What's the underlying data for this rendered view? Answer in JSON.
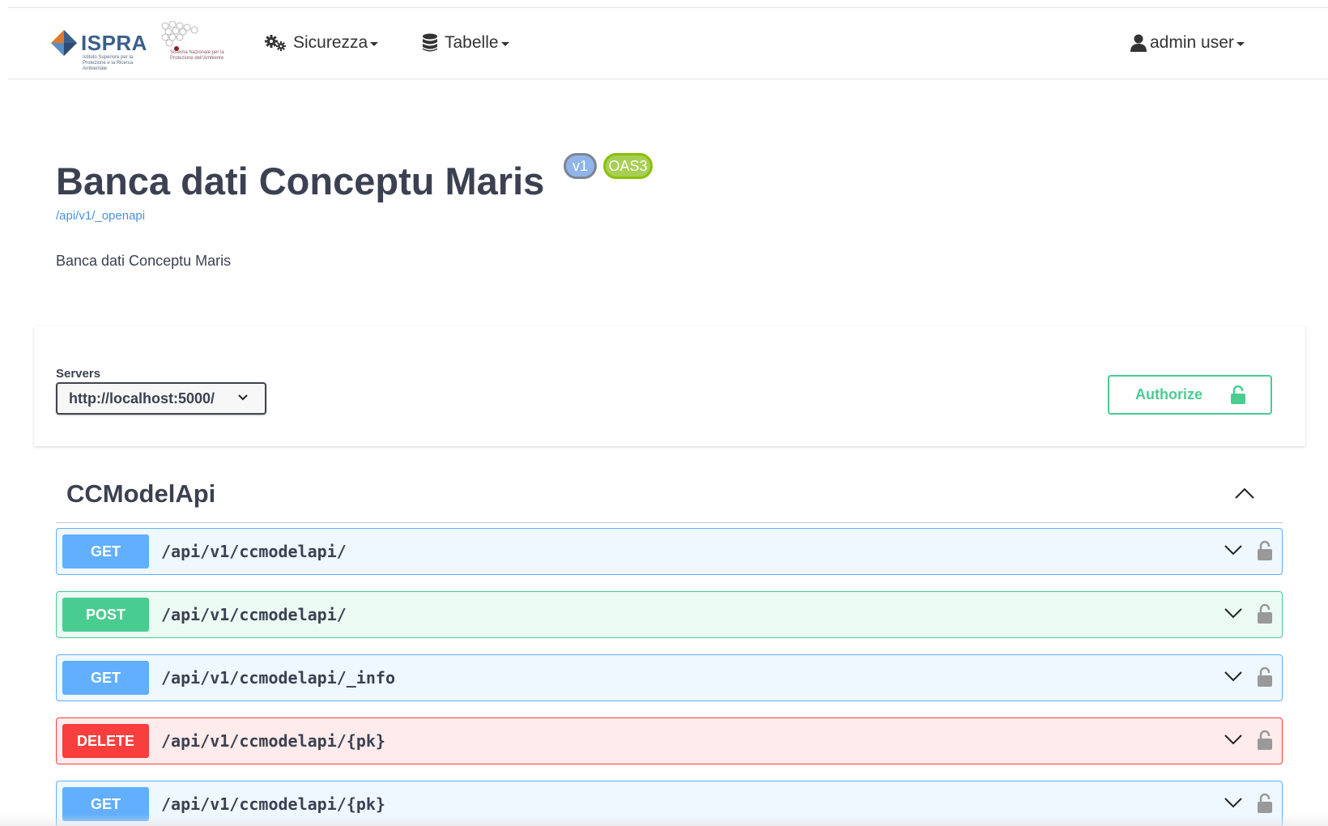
{
  "navbar": {
    "brand": {
      "ispra_name": "ISPRA",
      "ispra_sub": "Istituto Superiore per la Protezione e la Ricerca Ambientale",
      "snpa_sub": "Sistema Nazionale per la Protezione dell'Ambiente"
    },
    "menus": [
      {
        "label": "Sicurezza",
        "icon": "gears-icon"
      },
      {
        "label": "Tabelle",
        "icon": "database-icon"
      }
    ],
    "user": {
      "label": "admin user",
      "icon": "user-icon"
    }
  },
  "info": {
    "title": "Banca dati Conceptu Maris",
    "version_badge": "v1",
    "oas_badge": "OAS3",
    "url": "/api/v1/_openapi",
    "description": "Banca dati Conceptu Maris"
  },
  "servers": {
    "label": "Servers",
    "selected": "http://localhost:5000/"
  },
  "authorize": {
    "label": "Authorize"
  },
  "tag": {
    "name": "CCModelApi",
    "operations": [
      {
        "method": "GET",
        "path": "/api/v1/ccmodelapi/"
      },
      {
        "method": "POST",
        "path": "/api/v1/ccmodelapi/"
      },
      {
        "method": "GET",
        "path": "/api/v1/ccmodelapi/_info"
      },
      {
        "method": "DELETE",
        "path": "/api/v1/ccmodelapi/{pk}"
      },
      {
        "method": "GET",
        "path": "/api/v1/ccmodelapi/{pk}"
      }
    ]
  },
  "colors": {
    "get": "#61affe",
    "post": "#49cc90",
    "delete": "#f93e3e",
    "oas_badge": "#89bf04",
    "link": "#4990e2"
  }
}
